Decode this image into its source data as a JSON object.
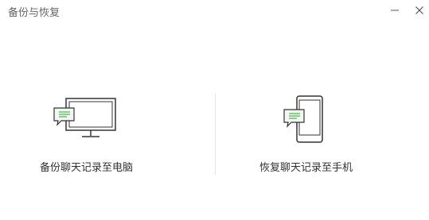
{
  "window": {
    "title": "备份与恢复"
  },
  "controls": {
    "minimize": "minimize-icon",
    "close": "close-icon"
  },
  "options": {
    "backup": {
      "label": "备份聊天记录至电脑",
      "icon": "monitor-chat-icon"
    },
    "restore": {
      "label": "恢复聊天记录至手机",
      "icon": "phone-chat-icon"
    }
  },
  "colors": {
    "accent": "#1aad19",
    "outline": "#333333",
    "bubble_fill": "#f2f2f2"
  }
}
